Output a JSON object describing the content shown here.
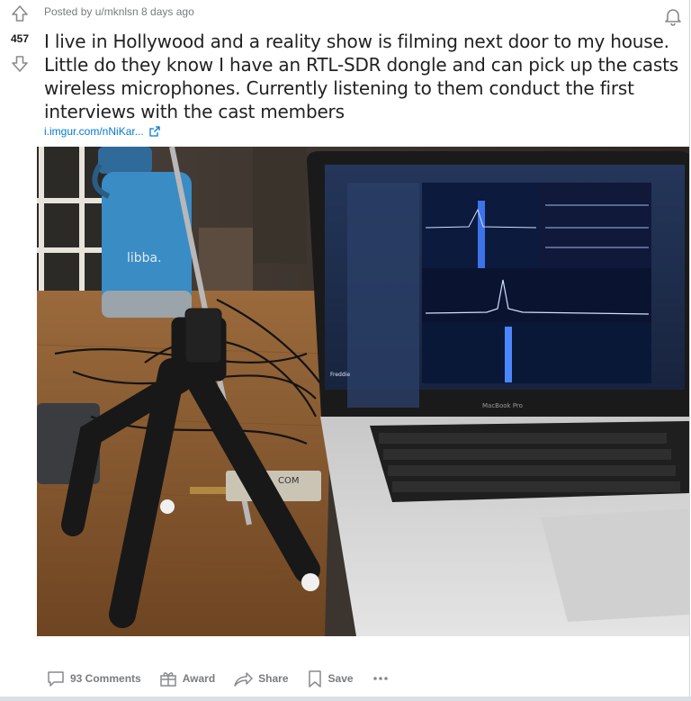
{
  "post": {
    "meta": "Posted by u/mknlsn 8 days ago",
    "score": "457",
    "title": "I live in Hollywood and a reality show is filming next door to my house. Little do they know I have an RTL-SDR dongle and can pick up the casts wireless microphones. Currently listening to them conduct the first interviews with the cast members",
    "link_text": "i.imgur.com/nNiKar..."
  },
  "image": {
    "bottle_text": "libba.",
    "dongle_text": "COM",
    "laptop_brand": "MacBook Pro",
    "app_name": "Freddie"
  },
  "actions": {
    "comments": "93 Comments",
    "award": "Award",
    "share": "Share",
    "save": "Save"
  },
  "colors": {
    "link": "#0079d3",
    "meta": "#787c7e",
    "title": "#222222"
  }
}
